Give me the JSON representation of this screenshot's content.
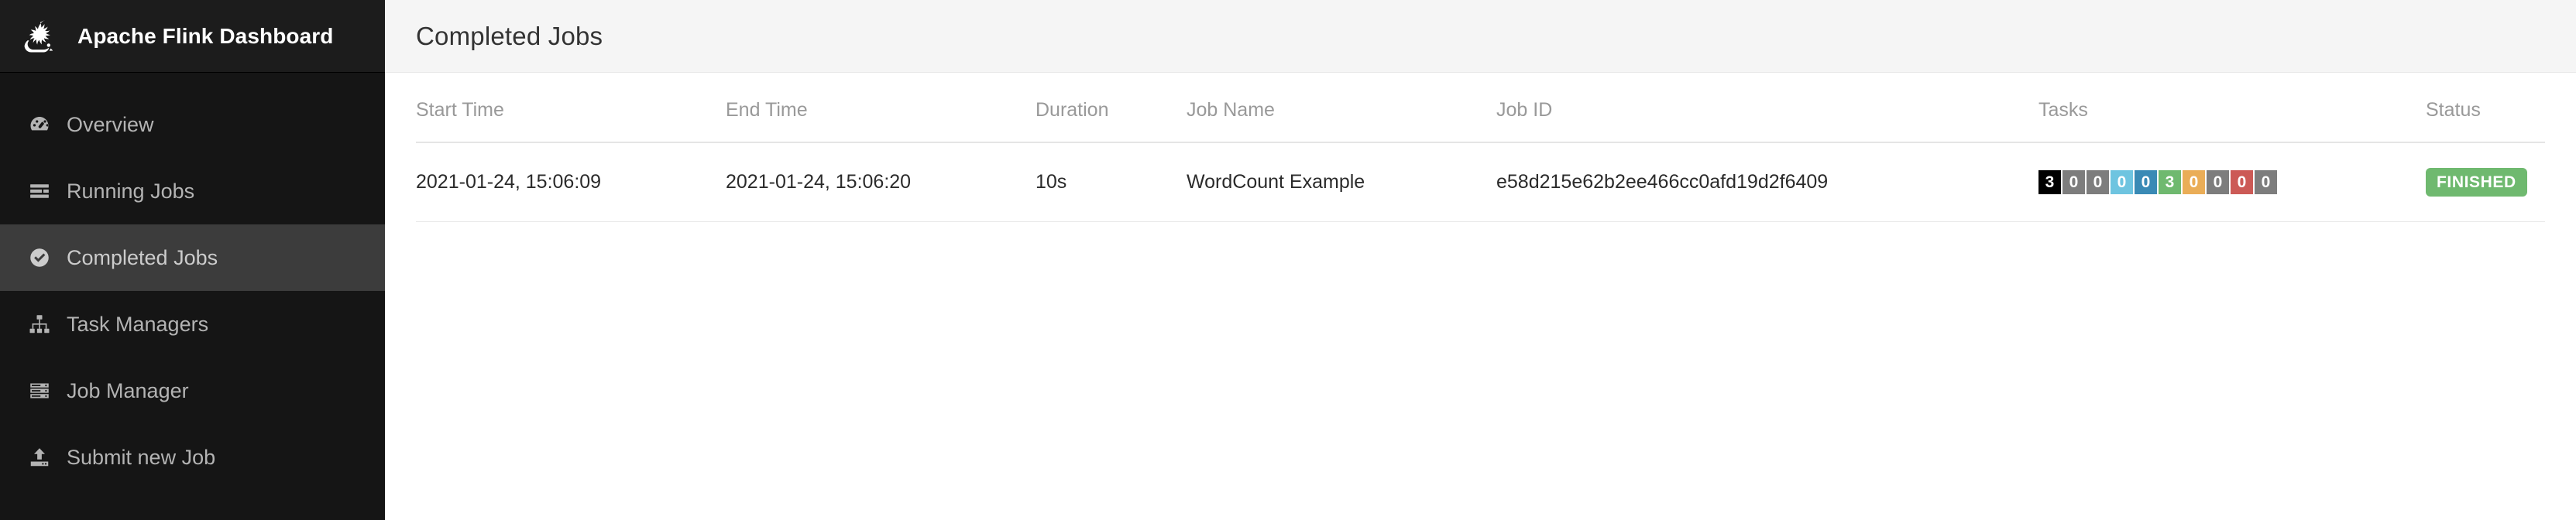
{
  "brand": {
    "title": "Apache Flink Dashboard",
    "logo_icon": "flink-squirrel-logo"
  },
  "sidebar": {
    "items": [
      {
        "label": "Overview",
        "icon": "dashboard-gauge-icon",
        "active": false
      },
      {
        "label": "Running Jobs",
        "icon": "running-jobs-list-icon",
        "active": false
      },
      {
        "label": "Completed Jobs",
        "icon": "check-circle-icon",
        "active": true
      },
      {
        "label": "Task Managers",
        "icon": "sitemap-icon",
        "active": false
      },
      {
        "label": "Job Manager",
        "icon": "server-rack-icon",
        "active": false
      },
      {
        "label": "Submit new Job",
        "icon": "upload-icon",
        "active": false
      }
    ]
  },
  "header": {
    "title": "Completed Jobs"
  },
  "table": {
    "columns": [
      "Start Time",
      "End Time",
      "Duration",
      "Job Name",
      "Job ID",
      "Tasks",
      "Status"
    ],
    "rows": [
      {
        "start_time": "2021-01-24, 15:06:09",
        "end_time": "2021-01-24, 15:06:20",
        "duration": "10s",
        "job_name": "WordCount Example",
        "job_id": "e58d215e62b2ee466cc0afd19d2f6409",
        "tasks": [
          {
            "value": "3",
            "state": "total",
            "color": "#000000"
          },
          {
            "value": "0",
            "state": "created",
            "color": "#7d7d7d"
          },
          {
            "value": "0",
            "state": "scheduled",
            "color": "#7d7d7d"
          },
          {
            "value": "0",
            "state": "deploying",
            "color": "#6ec4e0"
          },
          {
            "value": "0",
            "state": "running",
            "color": "#3a8ab5"
          },
          {
            "value": "3",
            "state": "finished",
            "color": "#6fb96f"
          },
          {
            "value": "0",
            "state": "canceling",
            "color": "#eaad57"
          },
          {
            "value": "0",
            "state": "canceled",
            "color": "#7d7d7d"
          },
          {
            "value": "0",
            "state": "failed",
            "color": "#cc5a56"
          },
          {
            "value": "0",
            "state": "reconciling",
            "color": "#7d7d7d"
          }
        ],
        "status": "FINISHED",
        "status_color": "#6fb96f"
      }
    ]
  }
}
